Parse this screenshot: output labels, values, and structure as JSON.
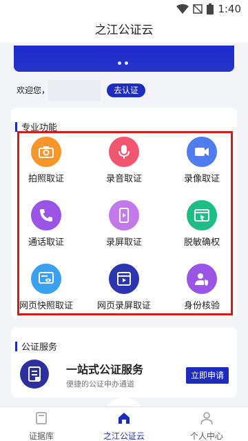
{
  "status_bar": {
    "time": "1:40"
  },
  "app": {
    "title": "之江公证云"
  },
  "welcome": {
    "label": "欢迎您，",
    "certify_button": "去认证"
  },
  "professional": {
    "title": "专业功能",
    "items": [
      {
        "label": "拍照取证",
        "icon": "camera-icon",
        "color": "#f8962a"
      },
      {
        "label": "录音取证",
        "icon": "microphone-icon",
        "color": "#f0566e"
      },
      {
        "label": "录像取证",
        "icon": "video-camera-icon",
        "color": "#4f7df0"
      },
      {
        "label": "通话取证",
        "icon": "phone-call-icon",
        "color": "#9b55e6"
      },
      {
        "label": "录屏取证",
        "icon": "screen-record-icon",
        "color": "#c27ae8"
      },
      {
        "label": "脱敏确权",
        "icon": "desensitize-icon",
        "color": "#1fbd86"
      },
      {
        "label": "网页快照取证",
        "icon": "web-snapshot-icon",
        "color": "#3aa0f0"
      },
      {
        "label": "网页录屏取证",
        "icon": "web-record-icon",
        "color": "#2b35b0"
      },
      {
        "label": "身份核验",
        "icon": "identity-verify-icon",
        "color": "#9b55e6"
      }
    ]
  },
  "service": {
    "title": "公证服务",
    "card_title": "一站式公证服务",
    "card_subtitle": "便捷的公证申办通道",
    "apply_button": "立即申请"
  },
  "nav": {
    "tabs": [
      {
        "label": "证据库",
        "icon": "folder-icon"
      },
      {
        "label": "之江公证云",
        "icon": "home-icon"
      },
      {
        "label": "个人中心",
        "icon": "person-icon"
      }
    ]
  }
}
